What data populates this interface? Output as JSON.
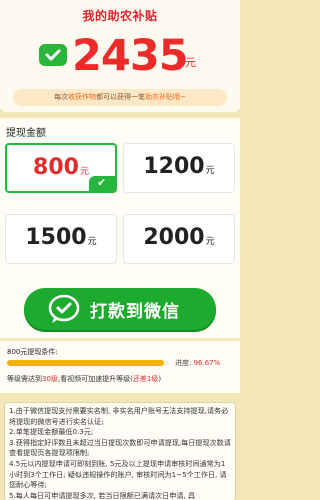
{
  "header": {
    "title": "我的助农补贴",
    "balance": "2435",
    "balance_unit": "元",
    "tip_prefix": "每次",
    "tip_highlight1": "收获作物",
    "tip_middle": "都可以获得一笔",
    "tip_highlight2": "助农补贴哦~"
  },
  "withdraw": {
    "section_title": "提现金额",
    "unit": "元",
    "options": [
      {
        "amount": "800",
        "selected": true
      },
      {
        "amount": "1200",
        "selected": false
      },
      {
        "amount": "1500",
        "selected": false
      },
      {
        "amount": "2000",
        "selected": false
      }
    ],
    "button_label": "打款到微信"
  },
  "progress": {
    "title": "800元提现条件:",
    "label": "进度:",
    "percent_text": "96.67%",
    "percent_value": 96.67,
    "desc_prefix": "等级需达到",
    "desc_level": "30级",
    "desc_middle": ",看视频可加速提升等级(",
    "desc_remaining": "还差1级",
    "desc_suffix": ")"
  },
  "rules": [
    "1.由于微信提现支付需要实名制, 非实名用户账号无法支持提现,请务必将提现的微信号进行实名认证;",
    "2.单笔提现金额最低0.3元;",
    "3.获得指定好评数且未超过当日提现次数即可申请提现,每日提现次数请查看提现页各提现项限制;",
    "4.5元以内提现申请可即刻到账, 5元及以上提现申请审核时间通常为1小时到3个工作日; 疑似违规操作的账户, 审核时间为1~5个工作日, 请您耐心等待;",
    "5.每人每日可申请提现多次, 若当日限额已满请次日申请, 具"
  ],
  "colors": {
    "accent_red": "#e42b2b",
    "wechat_green": "#1dab2f",
    "progress_yellow": "#f3b100",
    "page_bg": "#f3e6b8"
  }
}
